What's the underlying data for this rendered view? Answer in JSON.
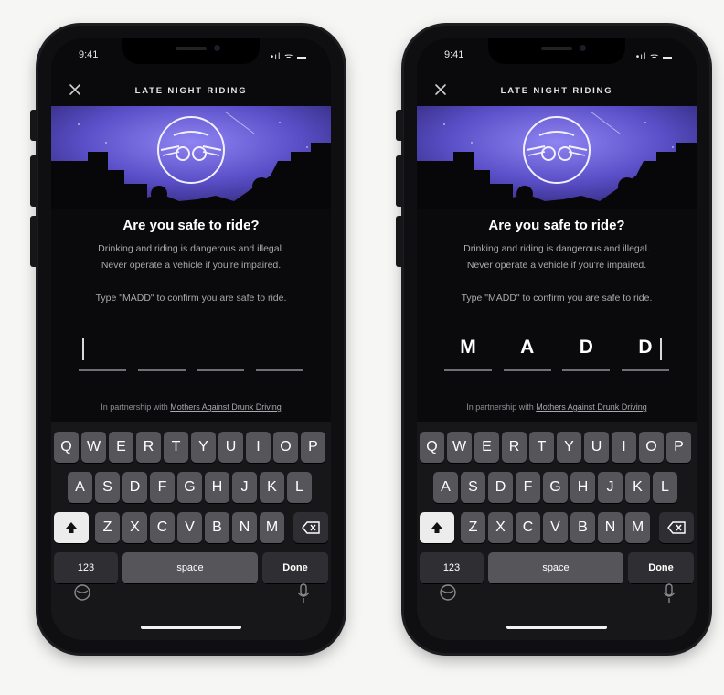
{
  "status": {
    "time": "9:41",
    "icons": "•ıl ᯤ ▬"
  },
  "nav": {
    "title": "LATE NIGHT RIDING"
  },
  "prompt": {
    "headline": "Are you safe to ride?",
    "body_line1": "Drinking and riding is dangerous and illegal.",
    "body_line2": "Never operate a vehicle if you're impaired.",
    "instruction": "Type \"MADD\" to confirm you are safe to ride."
  },
  "partnership": {
    "prefix": "In partnership with",
    "link": "Mothers Against Drunk Driving"
  },
  "screens": [
    {
      "code": [
        "",
        "",
        "",
        ""
      ]
    },
    {
      "code": [
        "M",
        "A",
        "D",
        "D"
      ]
    }
  ],
  "keyboard": {
    "row1": [
      "Q",
      "W",
      "E",
      "R",
      "T",
      "Y",
      "U",
      "I",
      "O",
      "P"
    ],
    "row2": [
      "A",
      "S",
      "D",
      "F",
      "G",
      "H",
      "J",
      "K",
      "L"
    ],
    "row3": [
      "Z",
      "X",
      "C",
      "V",
      "B",
      "N",
      "M"
    ],
    "numbers_key": "123",
    "space_key": "space",
    "done_key": "Done"
  },
  "colors": {
    "hero_purple": "#5b4fc8",
    "background": "#0a0a0c",
    "accent_white": "#ffffff"
  },
  "icons": [
    "close-icon",
    "bird-logo-icon",
    "shift-icon",
    "backspace-icon",
    "globe-icon",
    "mic-icon"
  ]
}
